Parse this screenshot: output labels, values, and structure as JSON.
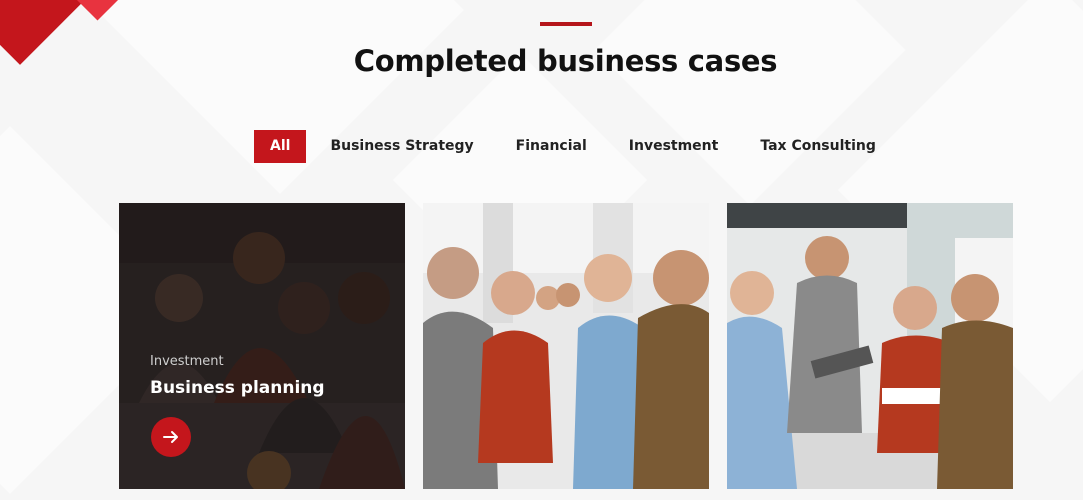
{
  "section": {
    "title": "Completed business cases"
  },
  "filters": {
    "items": [
      {
        "label": "All",
        "active": true
      },
      {
        "label": "Business Strategy",
        "active": false
      },
      {
        "label": "Financial",
        "active": false
      },
      {
        "label": "Investment",
        "active": false
      },
      {
        "label": "Tax Consulting",
        "active": false
      }
    ]
  },
  "cards": [
    {
      "category": "Investment",
      "title": "Business planning",
      "hovered": true,
      "icon": "arrow-right-icon"
    },
    {
      "category": "",
      "title": "",
      "hovered": false
    },
    {
      "category": "",
      "title": "",
      "hovered": false
    }
  ],
  "colors": {
    "accent": "#c4161c",
    "title": "#111111",
    "background": "#f6f6f6"
  }
}
